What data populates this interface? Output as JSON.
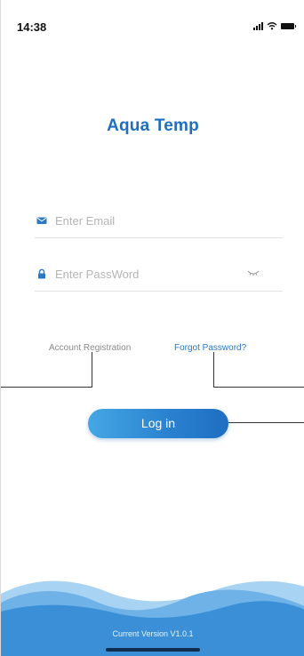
{
  "status_bar": {
    "time": "14:38"
  },
  "app": {
    "title": "Aqua Temp"
  },
  "form": {
    "email_placeholder": "Enter Email",
    "password_placeholder": "Enter PassWord"
  },
  "links": {
    "register": "Account Registration",
    "forgot": "Forgot Password?"
  },
  "login_button": "Log in",
  "footer": {
    "version": "Current Version V1.0.1"
  },
  "colors": {
    "accent": "#1e6fc0",
    "button": "#2a83d0",
    "wave": "#3a8fd6"
  },
  "icons": [
    "signal-icon",
    "wifi-icon",
    "battery-icon",
    "mail-icon",
    "lock-icon",
    "eye-icon"
  ]
}
